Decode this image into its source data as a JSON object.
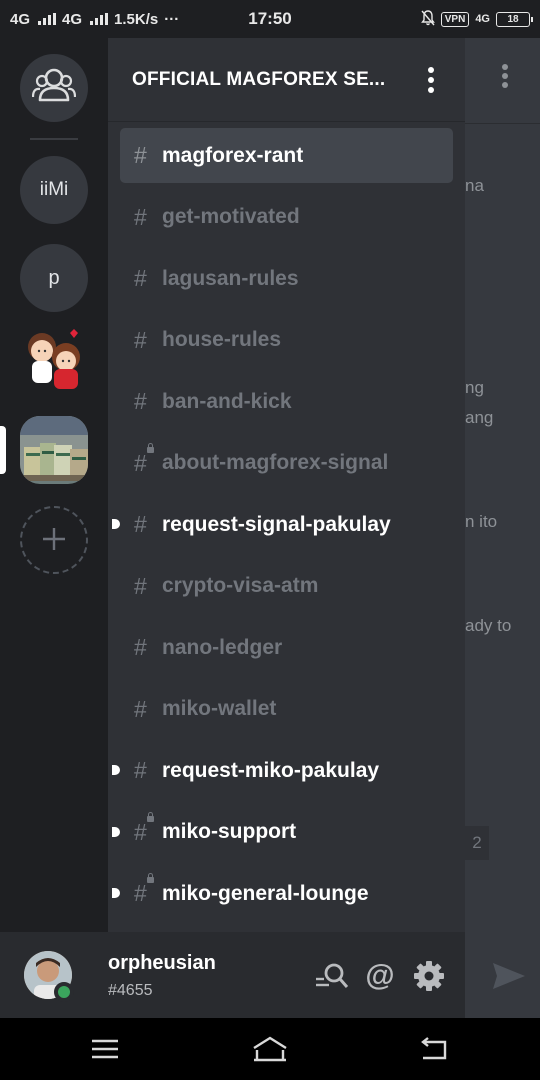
{
  "status_bar": {
    "net1": "4G",
    "net2": "4G",
    "speed": "1.5K/s",
    "more": "···",
    "time": "17:50",
    "vpn": "VPN",
    "net3": "4G",
    "battery": "18"
  },
  "rail": {
    "servers": [
      {
        "type": "direct-messages",
        "icon": "people-icon"
      },
      {
        "type": "text",
        "label": "iiMi"
      },
      {
        "type": "text",
        "label": "p"
      },
      {
        "type": "image",
        "icon": "couple-sticker"
      },
      {
        "type": "image",
        "icon": "money-stacks",
        "selected": true
      },
      {
        "type": "add",
        "icon": "plus-icon"
      }
    ]
  },
  "server": {
    "name": "OFFICIAL MAGFOREX SE..."
  },
  "channels": [
    {
      "name": "magforex-rant",
      "state": "selected",
      "locked": false,
      "unread": false
    },
    {
      "name": "get-motivated",
      "state": "muted",
      "locked": false,
      "unread": false
    },
    {
      "name": "lagusan-rules",
      "state": "muted",
      "locked": false,
      "unread": false
    },
    {
      "name": "house-rules",
      "state": "muted",
      "locked": false,
      "unread": false
    },
    {
      "name": "ban-and-kick",
      "state": "muted",
      "locked": false,
      "unread": false
    },
    {
      "name": "about-magforex-signal",
      "state": "muted",
      "locked": true,
      "unread": false
    },
    {
      "name": "request-signal-pakulay",
      "state": "unread",
      "locked": false,
      "unread": true
    },
    {
      "name": "crypto-visa-atm",
      "state": "muted",
      "locked": false,
      "unread": false
    },
    {
      "name": "nano-ledger",
      "state": "muted",
      "locked": false,
      "unread": false
    },
    {
      "name": "miko-wallet",
      "state": "muted",
      "locked": false,
      "unread": false
    },
    {
      "name": "request-miko-pakulay",
      "state": "unread",
      "locked": false,
      "unread": true
    },
    {
      "name": "miko-support",
      "state": "unread",
      "locked": true,
      "unread": true
    },
    {
      "name": "miko-general-lounge",
      "state": "unread",
      "locked": true,
      "unread": true
    }
  ],
  "background_chat": {
    "fragments": [
      "na",
      "ng",
      "ang",
      "n ito",
      "ady to",
      "2"
    ]
  },
  "user": {
    "username": "orpheusian",
    "discriminator": "#4655",
    "status": "online",
    "mention_symbol": "@"
  },
  "colors": {
    "bg_rail": "#1e1f22",
    "bg_panel": "#2f3136",
    "bg_selected": "#42464d",
    "text_muted": "#72767d",
    "text_active": "#ffffff",
    "online": "#3ba55d"
  },
  "navbar": {
    "icons": [
      "menu-icon",
      "home-icon",
      "back-icon"
    ]
  }
}
